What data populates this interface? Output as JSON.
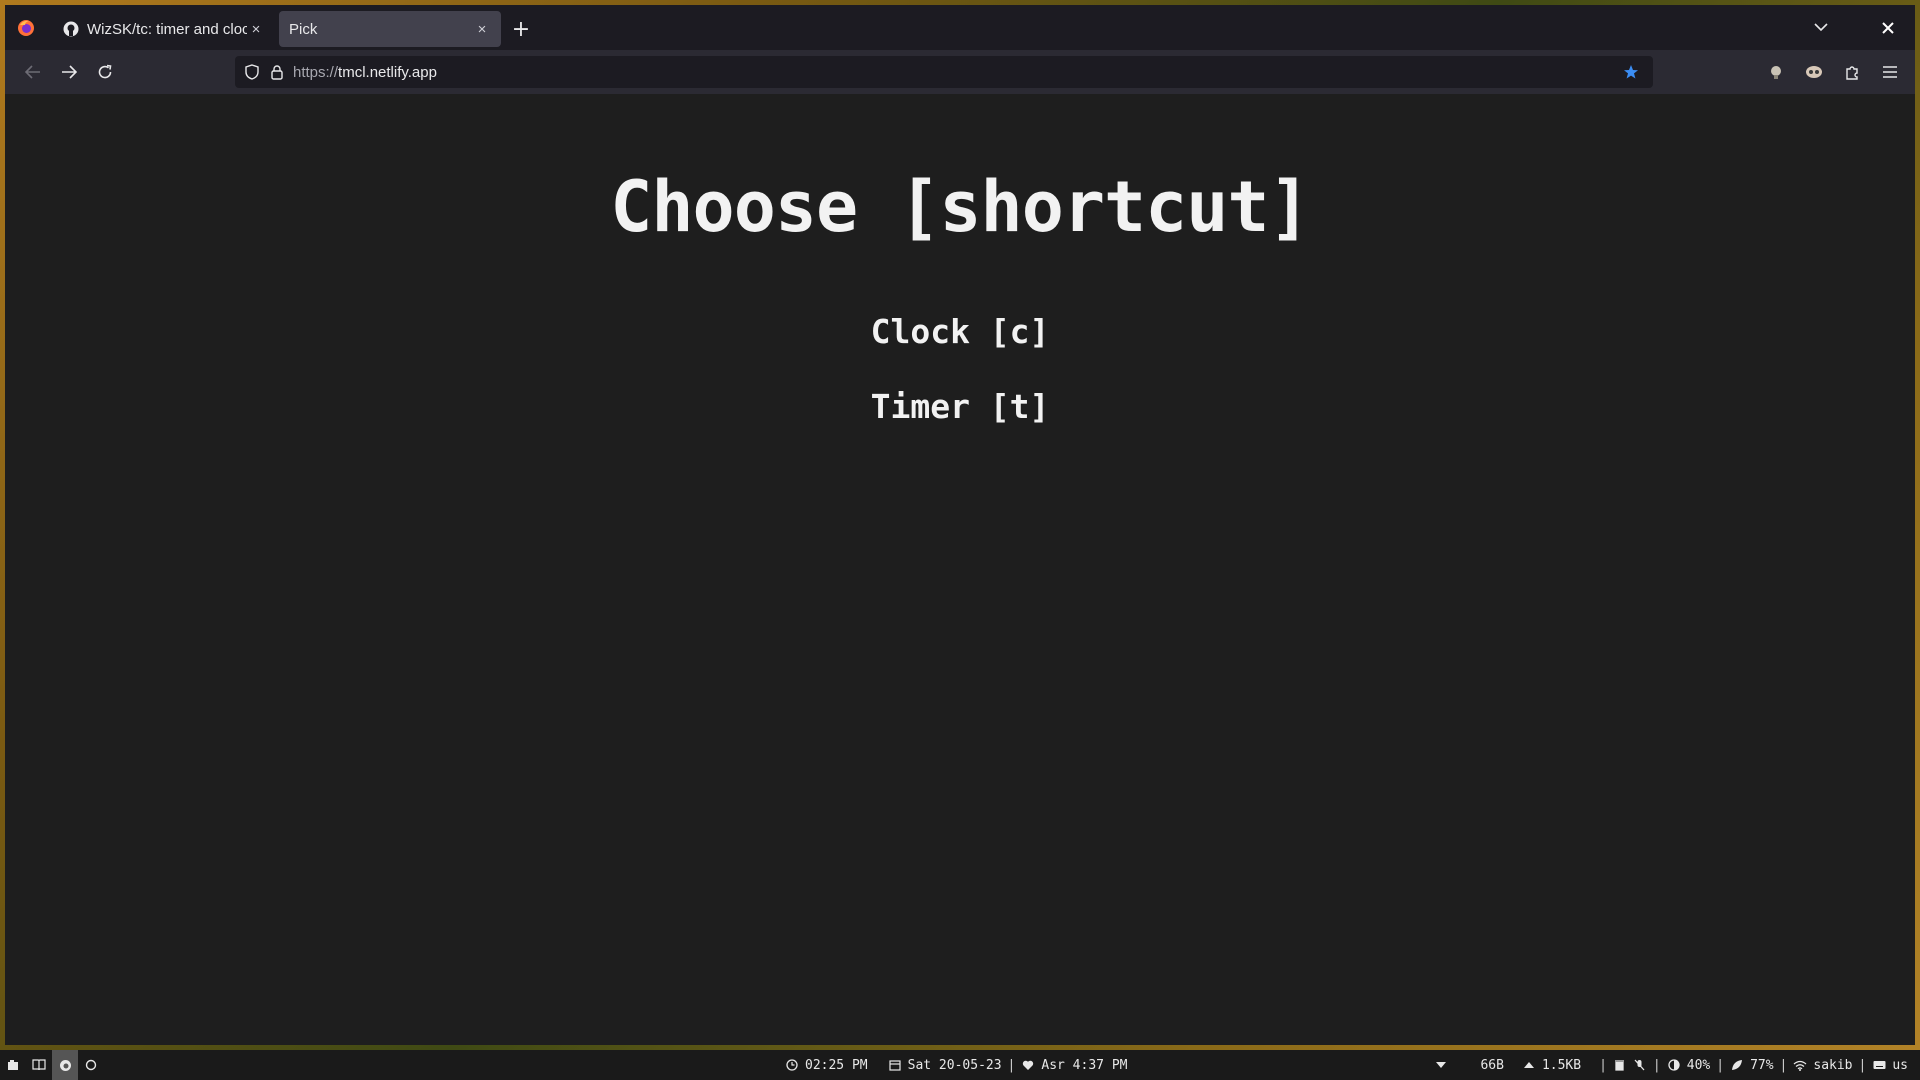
{
  "browser": {
    "tabs": [
      {
        "title": "WizSK/tc: timer and clock",
        "close": "×",
        "active": false
      },
      {
        "title": "Pick",
        "close": "×",
        "active": true
      }
    ],
    "new_tab": "+",
    "url": {
      "prefix": "https://",
      "host": "tmcl.netlify.app"
    },
    "icons": {
      "app_logo": "firefox-icon",
      "tab1_favicon": "github-icon",
      "tab_list": "chevron-down-icon",
      "close_window": "close-icon",
      "back": "arrow-left-icon",
      "forward": "arrow-right-icon",
      "reload": "reload-icon",
      "tracking": "shield-icon",
      "lock": "lock-icon",
      "bookmark": "star-icon",
      "bookmark_color": "#3b8df4"
    }
  },
  "page": {
    "heading": "Choose [shortcut]",
    "options": [
      {
        "label": "Clock [c]"
      },
      {
        "label": "Timer [t]"
      }
    ]
  },
  "statusbar": {
    "time": "02:25 PM",
    "date": "Sat 20-05-23",
    "prayer": "Asr 4:37 PM",
    "net_down": "66B",
    "net_up": "1.5KB",
    "brightness": "40%",
    "battery": "77%",
    "wifi": "sakib",
    "keyboard": "us",
    "sep": "|"
  }
}
